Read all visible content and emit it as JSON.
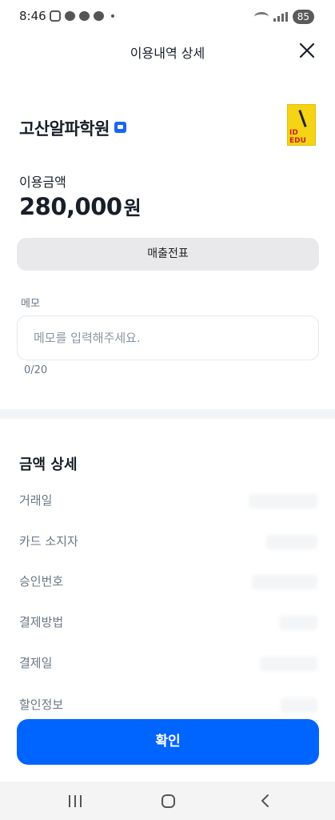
{
  "status_bar": {
    "time": "8:46",
    "battery": "85"
  },
  "header": {
    "title": "이용내역 상세"
  },
  "merchant": {
    "name": "고산알파학원",
    "logo_text_line1": "ID",
    "logo_text_line2": "EDU"
  },
  "amount": {
    "label": "이용금액",
    "value": "280,000",
    "unit": "원"
  },
  "slip_button": {
    "label": "매출전표"
  },
  "memo": {
    "label": "메모",
    "placeholder": "메모를 입력해주세요.",
    "value": "",
    "count": "0/20"
  },
  "details": {
    "title": "금액 상세",
    "rows": [
      {
        "label": "거래일"
      },
      {
        "label": "카드 소지자"
      },
      {
        "label": "승인번호"
      },
      {
        "label": "결제방법"
      },
      {
        "label": "결제일"
      },
      {
        "label": "할인정보"
      }
    ]
  },
  "confirm_button": {
    "label": "확인"
  },
  "colors": {
    "primary": "#0064ff",
    "badge": "#1b64f2"
  }
}
